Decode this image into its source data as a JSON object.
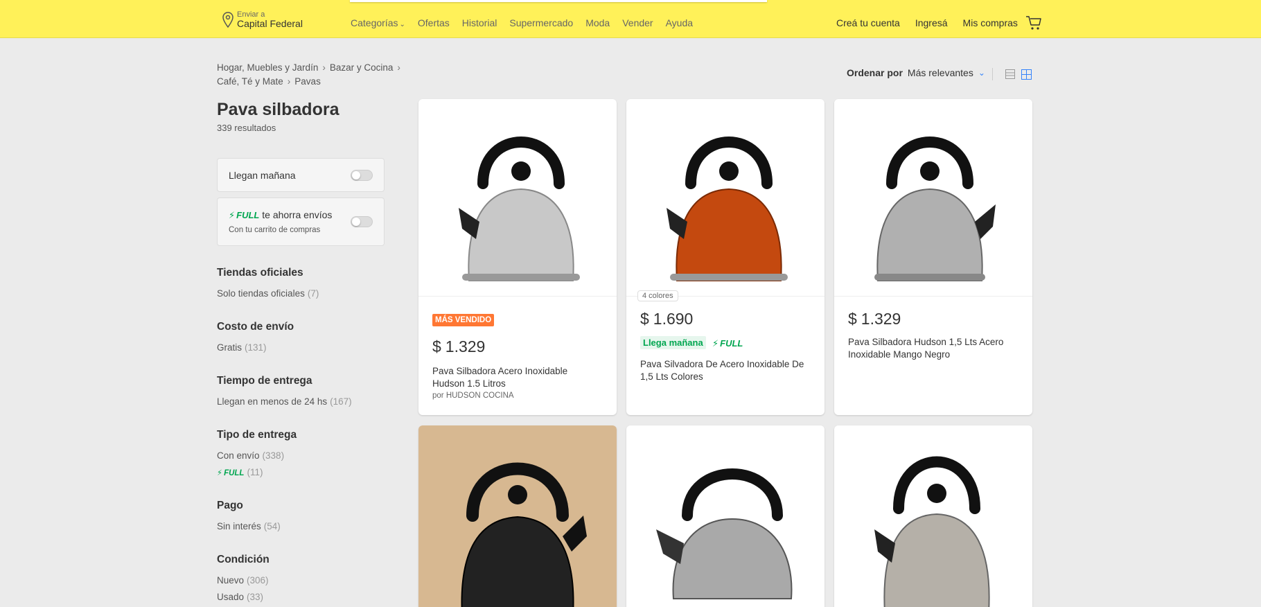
{
  "header": {
    "location_small": "Enviar a",
    "location_big": "Capital Federal",
    "nav": [
      "Categorías",
      "Ofertas",
      "Historial",
      "Supermercado",
      "Moda",
      "Vender",
      "Ayuda"
    ],
    "account": [
      "Creá tu cuenta",
      "Ingresá",
      "Mis compras"
    ],
    "brand_color": "#fff159"
  },
  "breadcrumb": [
    "Hogar, Muebles y Jardín",
    "Bazar y Cocina",
    "Café, Té y Mate",
    "Pavas"
  ],
  "sort": {
    "label": "Ordenar por",
    "value": "Más relevantes"
  },
  "page": {
    "title": "Pava silbadora",
    "results": "339 resultados"
  },
  "toggles": {
    "tomorrow": "Llegan mañana",
    "full_label": "FULL",
    "full_text": "te ahorra envíos",
    "full_sub": "Con tu carrito de compras"
  },
  "filters": [
    {
      "heading": "Tiendas oficiales",
      "items": [
        {
          "label": "Solo tiendas oficiales",
          "count": "(7)"
        }
      ]
    },
    {
      "heading": "Costo de envío",
      "items": [
        {
          "label": "Gratis",
          "count": "(131)"
        }
      ]
    },
    {
      "heading": "Tiempo de entrega",
      "items": [
        {
          "label": "Llegan en menos de 24 hs",
          "count": "(167)"
        }
      ]
    },
    {
      "heading": "Tipo de entrega",
      "items": [
        {
          "label": "Con envío",
          "count": "(338)"
        },
        {
          "label": "FULL",
          "count": "(11)"
        }
      ]
    },
    {
      "heading": "Pago",
      "items": [
        {
          "label": "Sin interés",
          "count": "(54)"
        }
      ]
    },
    {
      "heading": "Condición",
      "items": [
        {
          "label": "Nuevo",
          "count": "(306)"
        },
        {
          "label": "Usado",
          "count": "(33)"
        }
      ]
    }
  ],
  "products": [
    {
      "badge": "MÁS VENDIDO",
      "currency": "$",
      "price": "1.329",
      "title": "Pava Silbadora Acero Inoxidable Hudson 1.5 Litros",
      "seller": "por HUDSON COCINA",
      "body_color": "#c8c8c8"
    },
    {
      "colors": "4 colores",
      "currency": "$",
      "price": "1.690",
      "tomorrow": "Llega mañana",
      "full": "FULL",
      "title": "Pava Silvadora De Acero Inoxidable De 1,5 Lts Colores",
      "body_color": "#c4490f"
    },
    {
      "currency": "$",
      "price": "1.329",
      "title": "Pava Silbadora Hudson 1,5 Lts Acero Inoxidable Mango Negro",
      "body_color": "#b0b0b0"
    },
    {
      "body_color": "#222222"
    },
    {
      "body_color": "#a9a9a9"
    },
    {
      "body_color": "#b5b0a8"
    }
  ]
}
